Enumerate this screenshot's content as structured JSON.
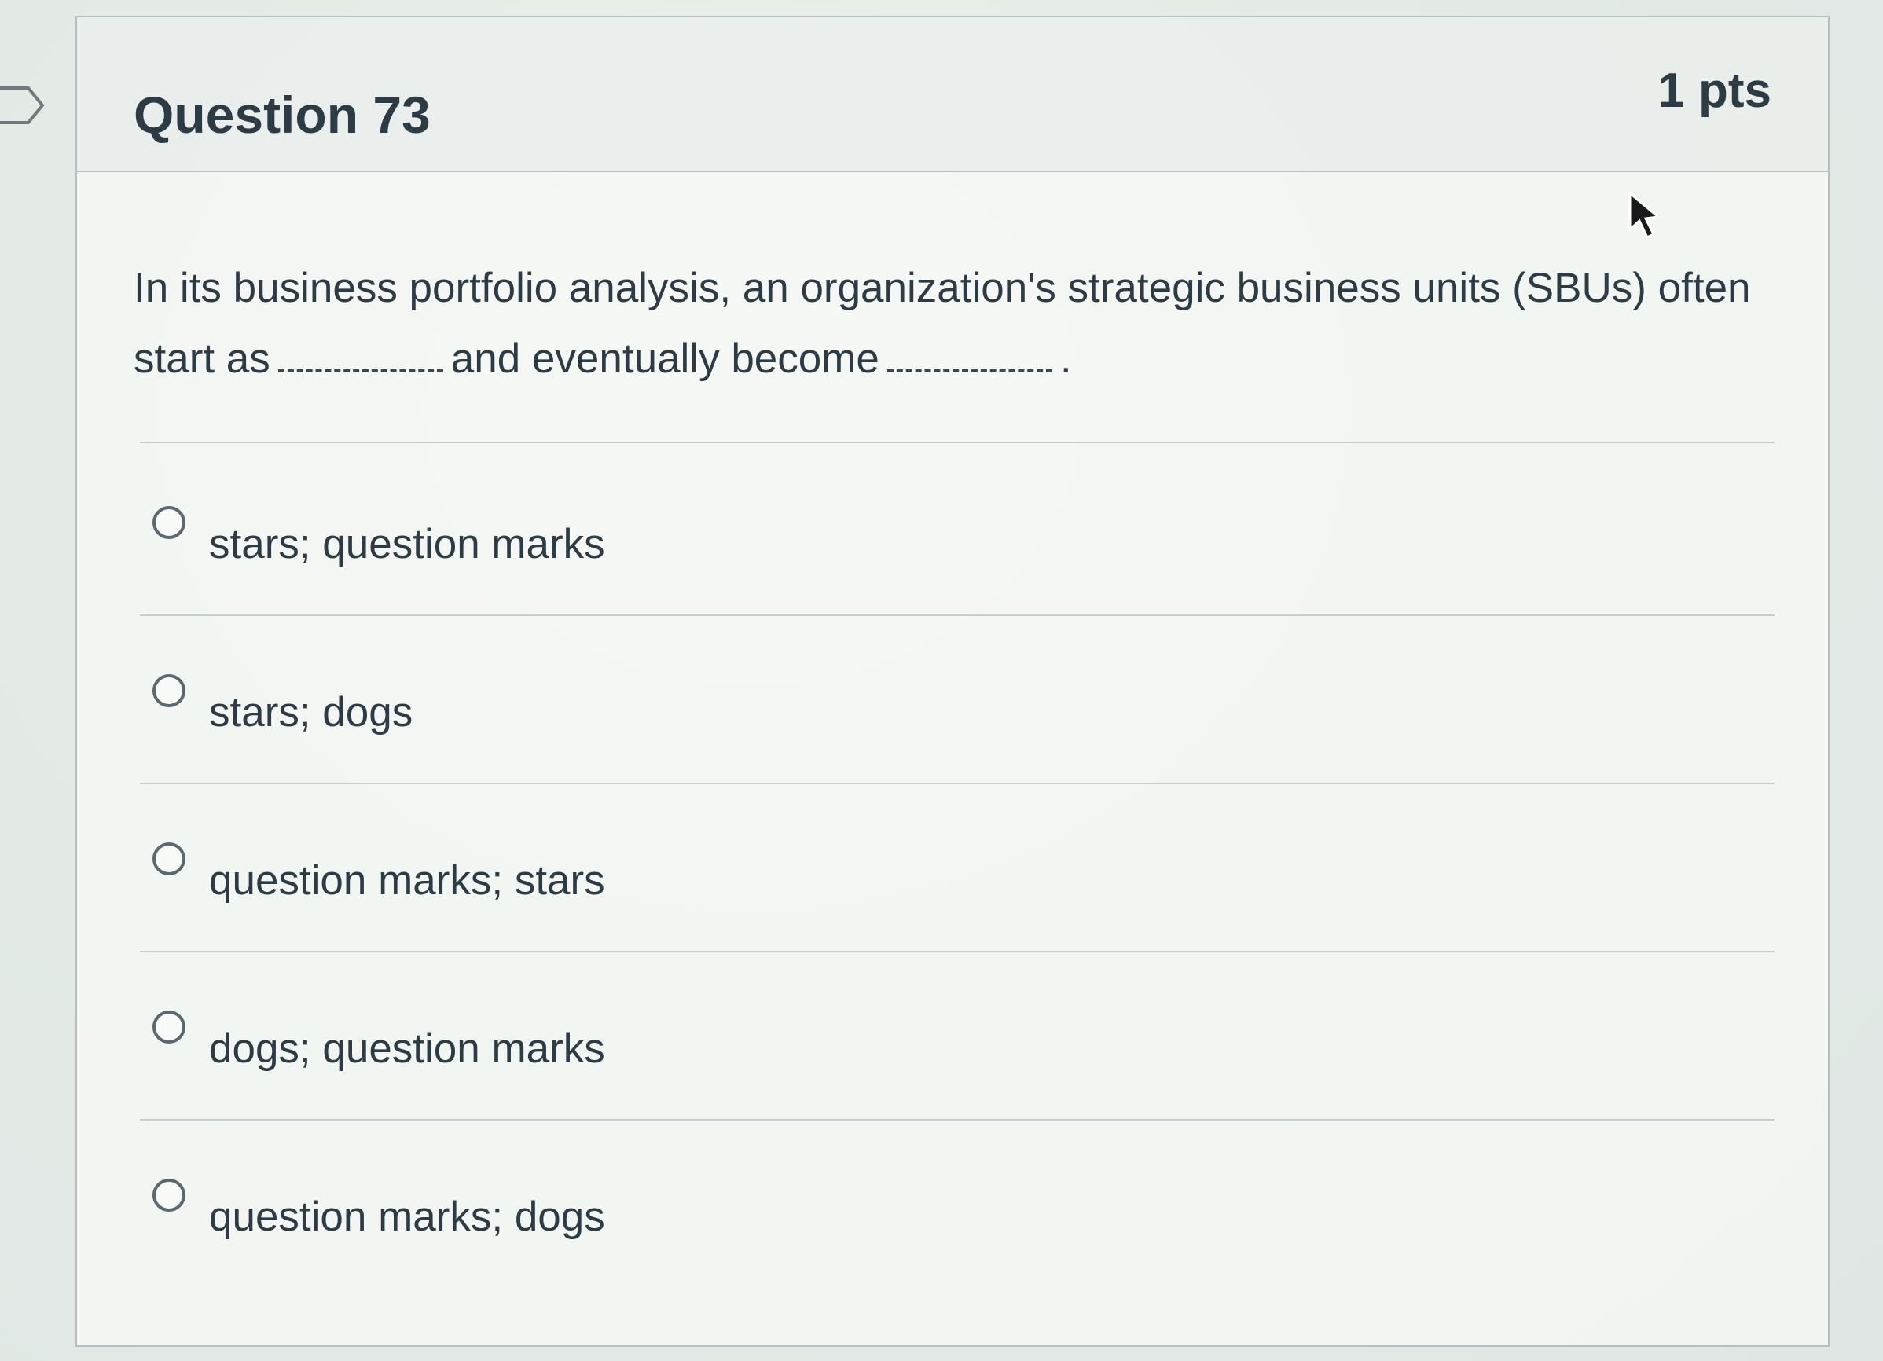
{
  "question": {
    "title": "Question 73",
    "points": "1 pts",
    "text_part1": "In its business portfolio analysis, an organization's strategic business units (SBUs) often start as",
    "text_part2": "and eventually become",
    "text_end": "."
  },
  "answers": [
    {
      "label": "stars; question marks"
    },
    {
      "label": "stars; dogs"
    },
    {
      "label": "question marks; stars"
    },
    {
      "label": "dogs; question marks"
    },
    {
      "label": "question marks; dogs"
    }
  ],
  "icons": {
    "bookmark": "bookmark-flag-icon",
    "cursor": "mouse-pointer-icon",
    "radio": "radio-unselected-icon"
  },
  "colors": {
    "text": "#2d3b45",
    "border": "#b7bec2",
    "radio": "#5b6870"
  }
}
